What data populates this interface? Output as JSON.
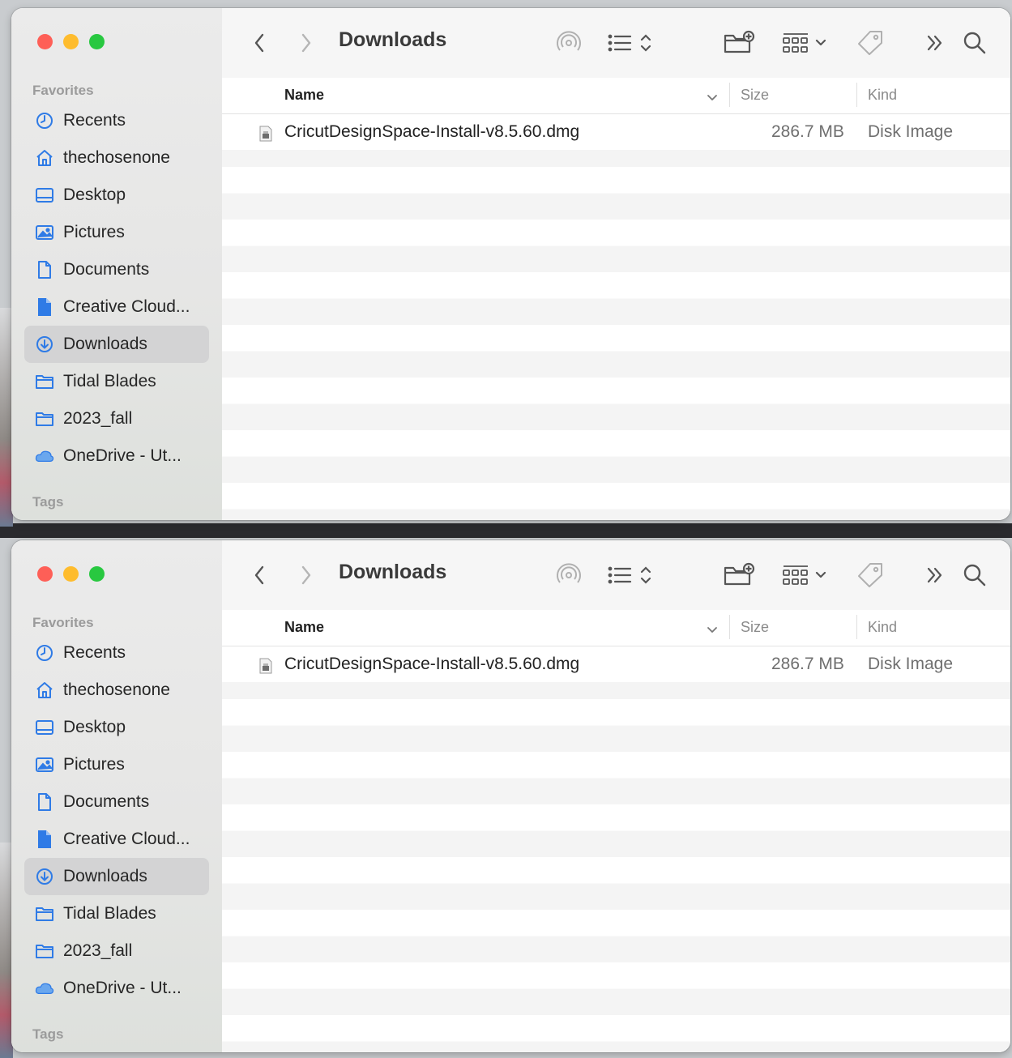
{
  "windows": [
    {
      "title": "Downloads",
      "sidebar": {
        "section_label": "Favorites",
        "tags_label": "Tags",
        "items": [
          {
            "label": "Recents",
            "icon": "clock-icon",
            "active": false
          },
          {
            "label": "thechosenone",
            "icon": "home-icon",
            "active": false
          },
          {
            "label": "Desktop",
            "icon": "desktop-icon",
            "active": false
          },
          {
            "label": "Pictures",
            "icon": "photo-icon",
            "active": false
          },
          {
            "label": "Documents",
            "icon": "document-icon",
            "active": false
          },
          {
            "label": "Creative Cloud...",
            "icon": "creative-cloud-file-icon",
            "active": false
          },
          {
            "label": "Downloads",
            "icon": "download-icon",
            "active": true
          },
          {
            "label": "Tidal Blades",
            "icon": "folder-icon",
            "active": false
          },
          {
            "label": "2023_fall",
            "icon": "folder-icon",
            "active": false
          },
          {
            "label": "OneDrive - Ut...",
            "icon": "cloud-icon",
            "active": false
          }
        ]
      },
      "columns": {
        "name": "Name",
        "size": "Size",
        "kind": "Kind"
      },
      "files": [
        {
          "name": "CricutDesignSpace-Install-v8.5.60.dmg",
          "size": "286.7 MB",
          "kind": "Disk Image"
        }
      ]
    },
    {
      "title": "Downloads",
      "sidebar": {
        "section_label": "Favorites",
        "tags_label": "Tags",
        "items": [
          {
            "label": "Recents",
            "icon": "clock-icon",
            "active": false
          },
          {
            "label": "thechosenone",
            "icon": "home-icon",
            "active": false
          },
          {
            "label": "Desktop",
            "icon": "desktop-icon",
            "active": false
          },
          {
            "label": "Pictures",
            "icon": "photo-icon",
            "active": false
          },
          {
            "label": "Documents",
            "icon": "document-icon",
            "active": false
          },
          {
            "label": "Creative Cloud...",
            "icon": "creative-cloud-file-icon",
            "active": false
          },
          {
            "label": "Downloads",
            "icon": "download-icon",
            "active": true
          },
          {
            "label": "Tidal Blades",
            "icon": "folder-icon",
            "active": false
          },
          {
            "label": "2023_fall",
            "icon": "folder-icon",
            "active": false
          },
          {
            "label": "OneDrive - Ut...",
            "icon": "cloud-icon",
            "active": false
          }
        ]
      },
      "columns": {
        "name": "Name",
        "size": "Size",
        "kind": "Kind"
      },
      "files": [
        {
          "name": "CricutDesignSpace-Install-v8.5.60.dmg",
          "size": "286.7 MB",
          "kind": "Disk Image"
        }
      ]
    }
  ],
  "colors": {
    "sidebar_icon": "#2f7be6",
    "close": "#fe5f57",
    "minimize": "#febc2e",
    "zoom": "#28c840"
  }
}
